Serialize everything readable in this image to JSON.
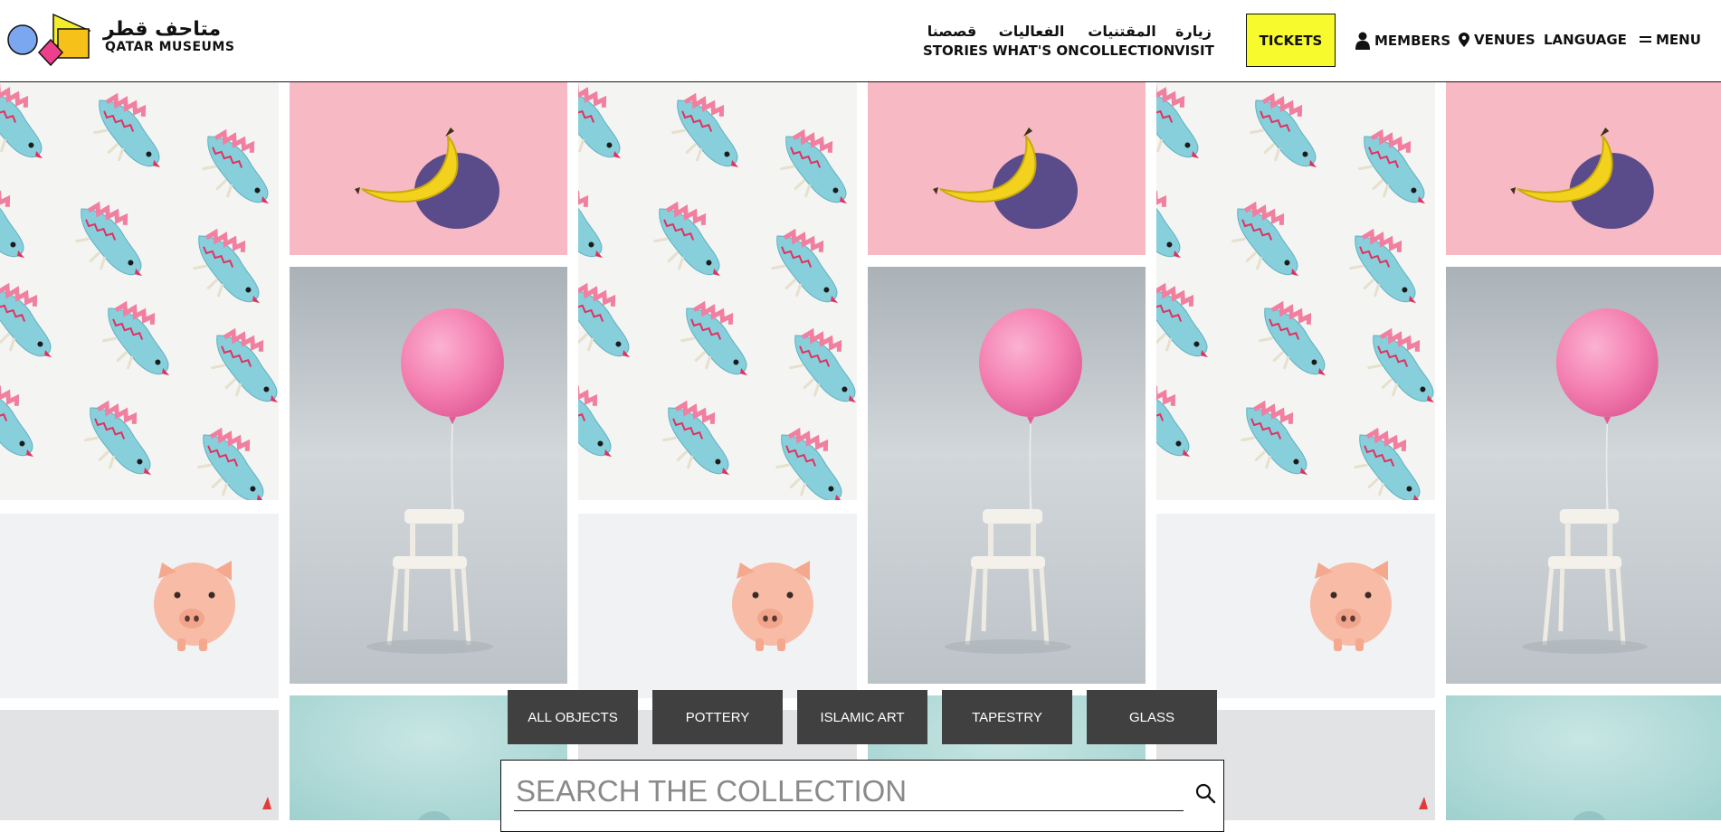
{
  "header": {
    "logo": {
      "arabic": "متاحف قطر",
      "english": "QATAR MUSEUMS"
    },
    "nav": [
      {
        "arabic": "قصصنا",
        "english": "STORIES"
      },
      {
        "arabic": "الفعاليات",
        "english": "WHAT'S ON"
      },
      {
        "arabic": "المقتنيات",
        "english": "COLLECTION"
      },
      {
        "arabic": "زيارة",
        "english": "VISIT"
      }
    ],
    "tickets_label": "TICKETS",
    "members_label": "MEMBERS",
    "venues_label": "VENUES",
    "language_label": "LANGUAGE",
    "menu_label": "MENU"
  },
  "filters": [
    "ALL OBJECTS",
    "POTTERY",
    "ISLAMIC ART",
    "TAPESTRY",
    "GLASS"
  ],
  "search": {
    "placeholder": "SEARCH THE COLLECTION",
    "value": ""
  },
  "colors": {
    "tickets_bg": "#f7fb2e",
    "filter_bg": "#404040",
    "banana_bg": "#f7b9c3",
    "balloon": "#f47fb1",
    "gray_bg": "#c5cbcf",
    "teal_bg": "#a8d3d1"
  },
  "icons": [
    "logo-shapes-icon",
    "person-icon",
    "location-pin-icon",
    "menu-lines-icon",
    "search-icon"
  ]
}
